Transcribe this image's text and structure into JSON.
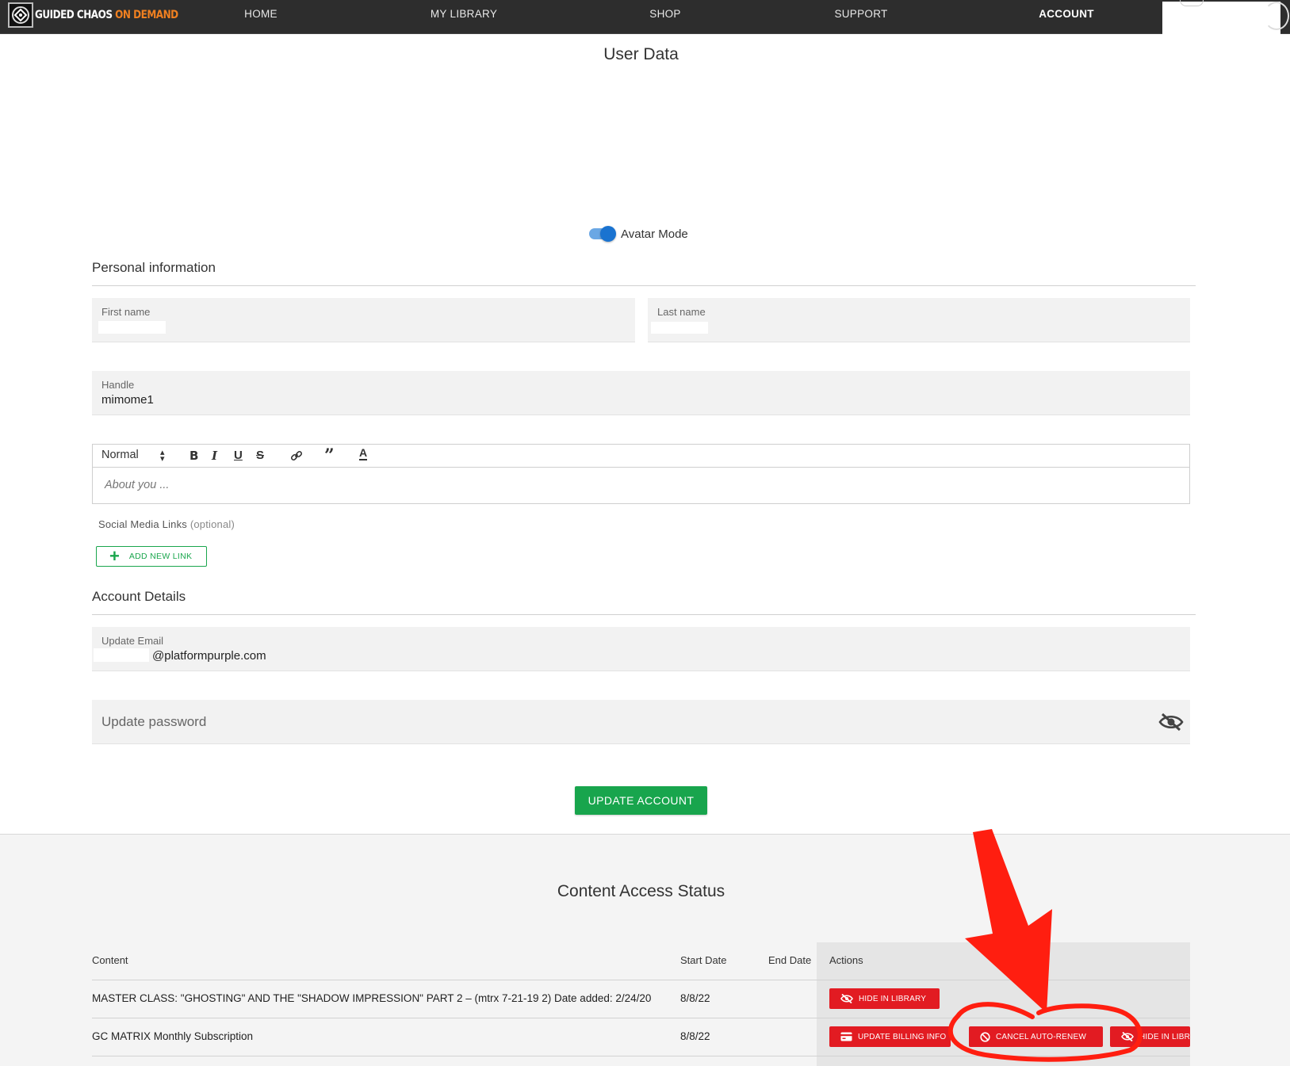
{
  "nav": {
    "logo_white": "GUIDED CHAOS",
    "logo_orange": "ON DEMAND",
    "items": [
      {
        "label": "HOME"
      },
      {
        "label": "MY LIBRARY"
      },
      {
        "label": "SHOP"
      },
      {
        "label": "SUPPORT"
      },
      {
        "label": "ACCOUNT"
      }
    ]
  },
  "page": {
    "title": "User Data",
    "avatar_toggle_label": "Avatar Mode",
    "avatar_toggle_on": true
  },
  "personal": {
    "title": "Personal information",
    "first_name_label": "First name",
    "last_name_label": "Last name",
    "handle_label": "Handle",
    "handle_value": "mimome1",
    "editor_format": "Normal",
    "editor_placeholder": "About you ...",
    "social_label": "Social Media Links",
    "social_optional": "(optional)",
    "add_link_label": "ADD NEW LINK"
  },
  "account": {
    "title": "Account Details",
    "email_label": "Update Email",
    "email_value": "@platformpurple.com",
    "password_placeholder": "Update password",
    "update_button": "UPDATE ACCOUNT"
  },
  "access": {
    "title": "Content Access Status",
    "columns": {
      "content": "Content",
      "start": "Start Date",
      "end": "End Date",
      "actions": "Actions"
    },
    "rows": [
      {
        "content": "MASTER CLASS: \"GHOSTING\" AND THE \"SHADOW IMPRESSION\" PART 2 – (mtrx 7-21-19 2) Date added: 2/24/20",
        "start": "8/8/22",
        "end": "",
        "actions": {
          "hide": "HIDE IN LIBRARY"
        }
      },
      {
        "content": "GC MATRIX Monthly Subscription",
        "start": "8/8/22",
        "end": "",
        "actions": {
          "billing": "UPDATE BILLING INFO",
          "cancel": "CANCEL AUTO-RENEW",
          "hide": "HIDE IN LIBRARY"
        }
      }
    ]
  },
  "colors": {
    "nav_bg": "#2d2d2d",
    "brand_orange": "#f08020",
    "primary_green": "#18a54d",
    "danger_red": "#e21b22",
    "toggle_blue": "#1a73d0",
    "annotation_red": "#ff1e10"
  }
}
